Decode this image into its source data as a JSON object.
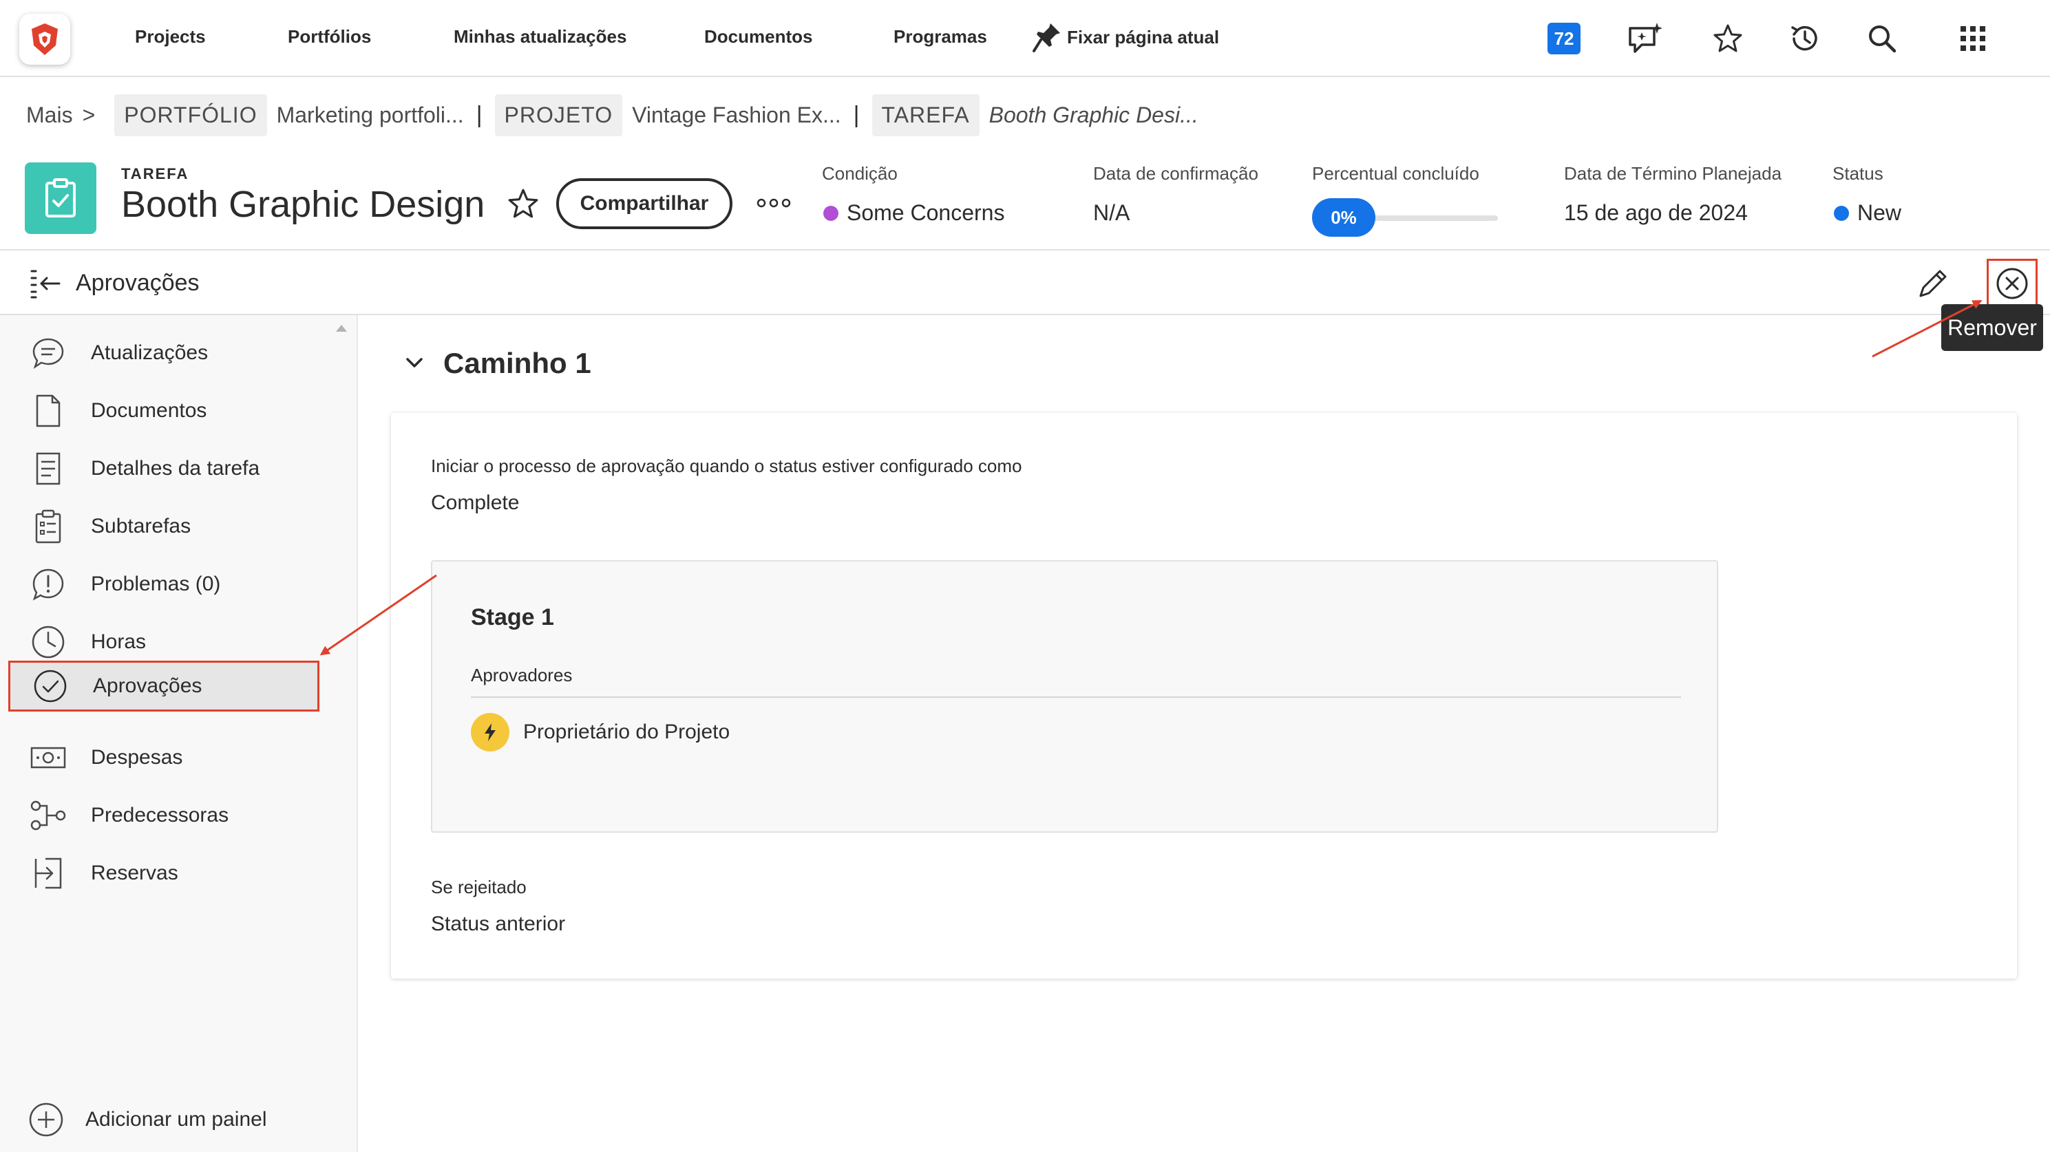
{
  "nav": {
    "links": [
      "Projects",
      "Portfólios",
      "Minhas atualizações",
      "Documentos",
      "Programas"
    ],
    "pin_label": "Fixar página atual",
    "notifications_count": "72"
  },
  "breadcrumb": {
    "more": "Mais",
    "portfolio_tag": "PORTFÓLIO",
    "portfolio_name": "Marketing portfoli...",
    "project_tag": "PROJETO",
    "project_name": "Vintage Fashion Ex...",
    "task_tag": "TAREFA",
    "task_name": "Booth Graphic Desi..."
  },
  "header": {
    "object_type": "TAREFA",
    "title": "Booth Graphic Design",
    "share_label": "Compartilhar",
    "condition_label": "Condição",
    "condition_value": "Some Concerns",
    "commit_label": "Data de confirmação",
    "commit_value": "N/A",
    "percent_label": "Percentual concluído",
    "percent_value": "0%",
    "planned_label": "Data de Término Planejada",
    "planned_value": "15 de ago de 2024",
    "status_label": "Status",
    "status_value": "New"
  },
  "colors": {
    "condition": "#b04fd6",
    "status": "#1473e6",
    "accent": "#1473e6",
    "highlight": "#e0402d"
  },
  "panel": {
    "title": "Aprovações",
    "tooltip": "Remover"
  },
  "sidebar": {
    "items": [
      {
        "label": "Atualizações",
        "icon": "comment-icon"
      },
      {
        "label": "Documentos",
        "icon": "document-icon"
      },
      {
        "label": "Detalhes da tarefa",
        "icon": "details-icon"
      },
      {
        "label": "Subtarefas",
        "icon": "clipboard-list-icon"
      },
      {
        "label": "Problemas (0)",
        "icon": "issue-alert-icon"
      },
      {
        "label": "Horas",
        "icon": "clock-icon"
      },
      {
        "label": "Aprovações",
        "icon": "check-circle-icon"
      },
      {
        "label": "Despesas",
        "icon": "money-icon"
      },
      {
        "label": "Predecessoras",
        "icon": "flow-icon"
      },
      {
        "label": "Reservas",
        "icon": "login-icon"
      }
    ],
    "active_index": 6,
    "add_panel": "Adicionar um painel"
  },
  "approval": {
    "path_name": "Caminho 1",
    "start_label": "Iniciar o processo de aprovação quando o status estiver configurado como",
    "start_value": "Complete",
    "stage_name": "Stage 1",
    "approvers_label": "Aprovadores",
    "approver_name": "Proprietário do Projeto",
    "rejected_label": "Se rejeitado",
    "rejected_value": "Status anterior"
  }
}
